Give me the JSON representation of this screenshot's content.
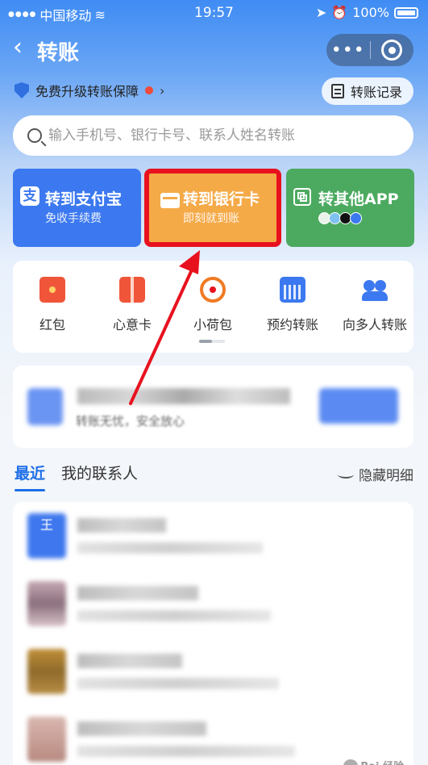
{
  "status_bar": {
    "carrier": "中国移动",
    "time": "19:57",
    "battery": "100%"
  },
  "nav": {
    "back_icon": "chevron-left-icon",
    "title": "转账",
    "more_icon": "more-dots-icon",
    "close_icon": "target-ring-icon"
  },
  "upgrade": {
    "label": "免费升级转账保障",
    "records_label": "转账记录"
  },
  "search": {
    "placeholder": "输入手机号、银行卡号、联系人姓名转账"
  },
  "transfer_cards": [
    {
      "title": "转到支付宝",
      "subtitle": "免收手续费",
      "icon": "alipay-icon",
      "color": "#3c79f0"
    },
    {
      "title": "转到银行卡",
      "subtitle": "即刻就到账",
      "icon": "bank-card-icon",
      "color": "#f5aa48",
      "highlighted": true
    },
    {
      "title": "转其他APP",
      "subtitle": "",
      "icon": "qr-code-icon",
      "color": "#4caa60"
    }
  ],
  "quick_actions": [
    {
      "label": "红包",
      "icon": "red-envelope-icon"
    },
    {
      "label": "心意卡",
      "icon": "gift-card-icon"
    },
    {
      "label": "小荷包",
      "icon": "lotus-pouch-icon"
    },
    {
      "label": "预约转账",
      "icon": "calendar-icon"
    },
    {
      "label": "向多人转账",
      "icon": "people-icon"
    }
  ],
  "promo": {
    "subtitle": "转账无忧，安全放心"
  },
  "tabs": {
    "recent": "最近",
    "contacts": "我的联系人",
    "hide_detail": "隐藏明细"
  },
  "contacts": [
    {
      "avatar_text": "王"
    },
    {
      "avatar_text": ""
    },
    {
      "avatar_text": ""
    },
    {
      "avatar_text": ""
    }
  ],
  "watermark": "Bai 经验",
  "colors": {
    "primary": "#1f6fe8",
    "highlight_border": "#e8121f",
    "annotation_arrow": "#e8121f"
  }
}
